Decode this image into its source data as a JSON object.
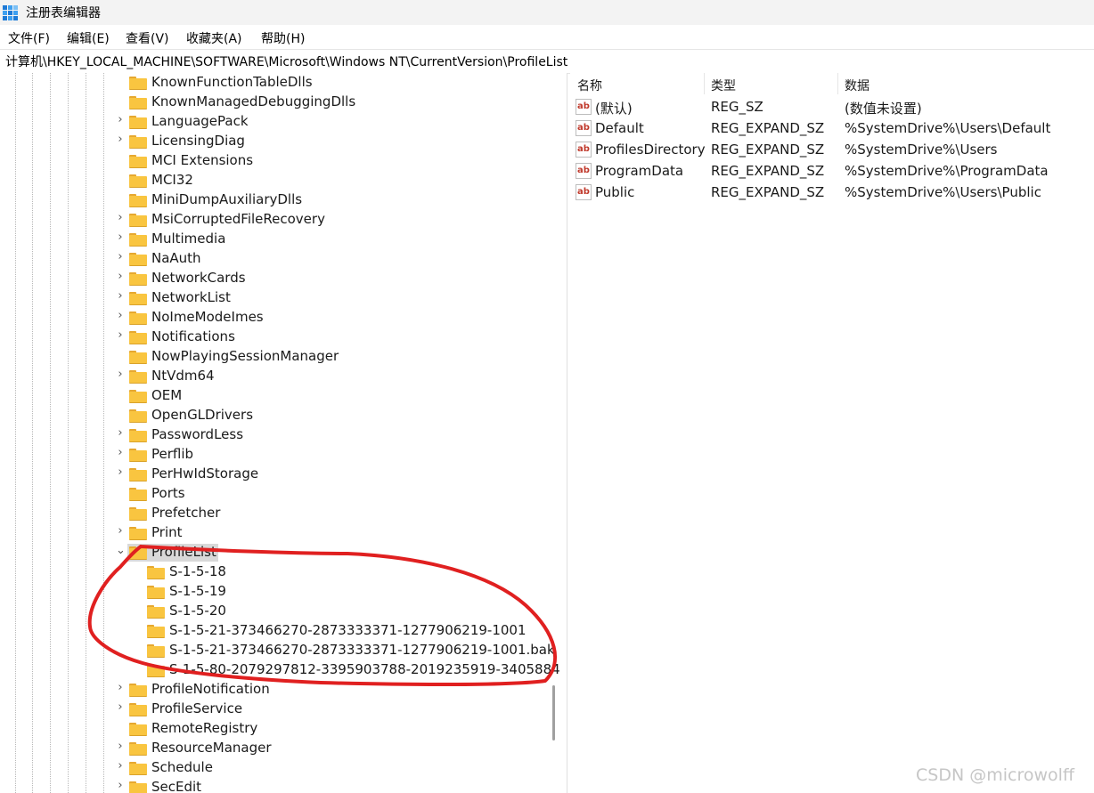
{
  "window": {
    "title": "注册表编辑器"
  },
  "menu": [
    "文件(F)",
    "编辑(E)",
    "查看(V)",
    "收藏夹(A)",
    "帮助(H)"
  ],
  "address": "计算机\\HKEY_LOCAL_MACHINE\\SOFTWARE\\Microsoft\\Windows NT\\CurrentVersion\\ProfileList",
  "tree": {
    "items": [
      {
        "label": "KnownFunctionTableDlls",
        "expandable": false,
        "level": 0
      },
      {
        "label": "KnownManagedDebuggingDlls",
        "expandable": false,
        "level": 0
      },
      {
        "label": "LanguagePack",
        "expandable": true,
        "level": 0
      },
      {
        "label": "LicensingDiag",
        "expandable": true,
        "level": 0
      },
      {
        "label": "MCI Extensions",
        "expandable": false,
        "level": 0
      },
      {
        "label": "MCI32",
        "expandable": false,
        "level": 0
      },
      {
        "label": "MiniDumpAuxiliaryDlls",
        "expandable": false,
        "level": 0
      },
      {
        "label": "MsiCorruptedFileRecovery",
        "expandable": true,
        "level": 0
      },
      {
        "label": "Multimedia",
        "expandable": true,
        "level": 0
      },
      {
        "label": "NaAuth",
        "expandable": true,
        "level": 0
      },
      {
        "label": "NetworkCards",
        "expandable": true,
        "level": 0
      },
      {
        "label": "NetworkList",
        "expandable": true,
        "level": 0
      },
      {
        "label": "NoImeModeImes",
        "expandable": true,
        "level": 0
      },
      {
        "label": "Notifications",
        "expandable": true,
        "level": 0
      },
      {
        "label": "NowPlayingSessionManager",
        "expandable": false,
        "level": 0
      },
      {
        "label": "NtVdm64",
        "expandable": true,
        "level": 0
      },
      {
        "label": "OEM",
        "expandable": false,
        "level": 0
      },
      {
        "label": "OpenGLDrivers",
        "expandable": false,
        "level": 0
      },
      {
        "label": "PasswordLess",
        "expandable": true,
        "level": 0
      },
      {
        "label": "Perflib",
        "expandable": true,
        "level": 0
      },
      {
        "label": "PerHwIdStorage",
        "expandable": true,
        "level": 0
      },
      {
        "label": "Ports",
        "expandable": false,
        "level": 0
      },
      {
        "label": "Prefetcher",
        "expandable": false,
        "level": 0
      },
      {
        "label": "Print",
        "expandable": true,
        "level": 0
      },
      {
        "label": "ProfileList",
        "expandable": true,
        "expanded": true,
        "selected": true,
        "level": 0
      },
      {
        "label": "S-1-5-18",
        "expandable": false,
        "level": 1
      },
      {
        "label": "S-1-5-19",
        "expandable": false,
        "level": 1
      },
      {
        "label": "S-1-5-20",
        "expandable": false,
        "level": 1
      },
      {
        "label": "S-1-5-21-373466270-2873333371-1277906219-1001",
        "expandable": false,
        "level": 1
      },
      {
        "label": "S-1-5-21-373466270-2873333371-1277906219-1001.bak",
        "expandable": false,
        "level": 1
      },
      {
        "label": "S-1-5-80-2079297812-3395903788-2019235919-3405884",
        "expandable": false,
        "level": 1
      },
      {
        "label": "ProfileNotification",
        "expandable": true,
        "level": 0
      },
      {
        "label": "ProfileService",
        "expandable": true,
        "level": 0
      },
      {
        "label": "RemoteRegistry",
        "expandable": false,
        "level": 0
      },
      {
        "label": "ResourceManager",
        "expandable": true,
        "level": 0
      },
      {
        "label": "Schedule",
        "expandable": true,
        "level": 0
      },
      {
        "label": "SecEdit",
        "expandable": true,
        "level": 0
      }
    ]
  },
  "list": {
    "headers": {
      "name": "名称",
      "type": "类型",
      "data": "数据"
    },
    "rows": [
      {
        "name": "(默认)",
        "type": "REG_SZ",
        "data": "(数值未设置)"
      },
      {
        "name": "Default",
        "type": "REG_EXPAND_SZ",
        "data": "%SystemDrive%\\Users\\Default"
      },
      {
        "name": "ProfilesDirectory",
        "type": "REG_EXPAND_SZ",
        "data": "%SystemDrive%\\Users"
      },
      {
        "name": "ProgramData",
        "type": "REG_EXPAND_SZ",
        "data": "%SystemDrive%\\ProgramData"
      },
      {
        "name": "Public",
        "type": "REG_EXPAND_SZ",
        "data": "%SystemDrive%\\Users\\Public"
      }
    ]
  },
  "icons": {
    "app": "registry-editor-icon",
    "folder": "folder-icon",
    "value": "string-value-icon",
    "expand": "chevron-right-icon",
    "collapse": "chevron-down-icon"
  },
  "colors": {
    "annotation": "#e02020",
    "folder": "#f9c540",
    "selection": "#d9d9d9"
  },
  "watermark": "CSDN @microwolff"
}
